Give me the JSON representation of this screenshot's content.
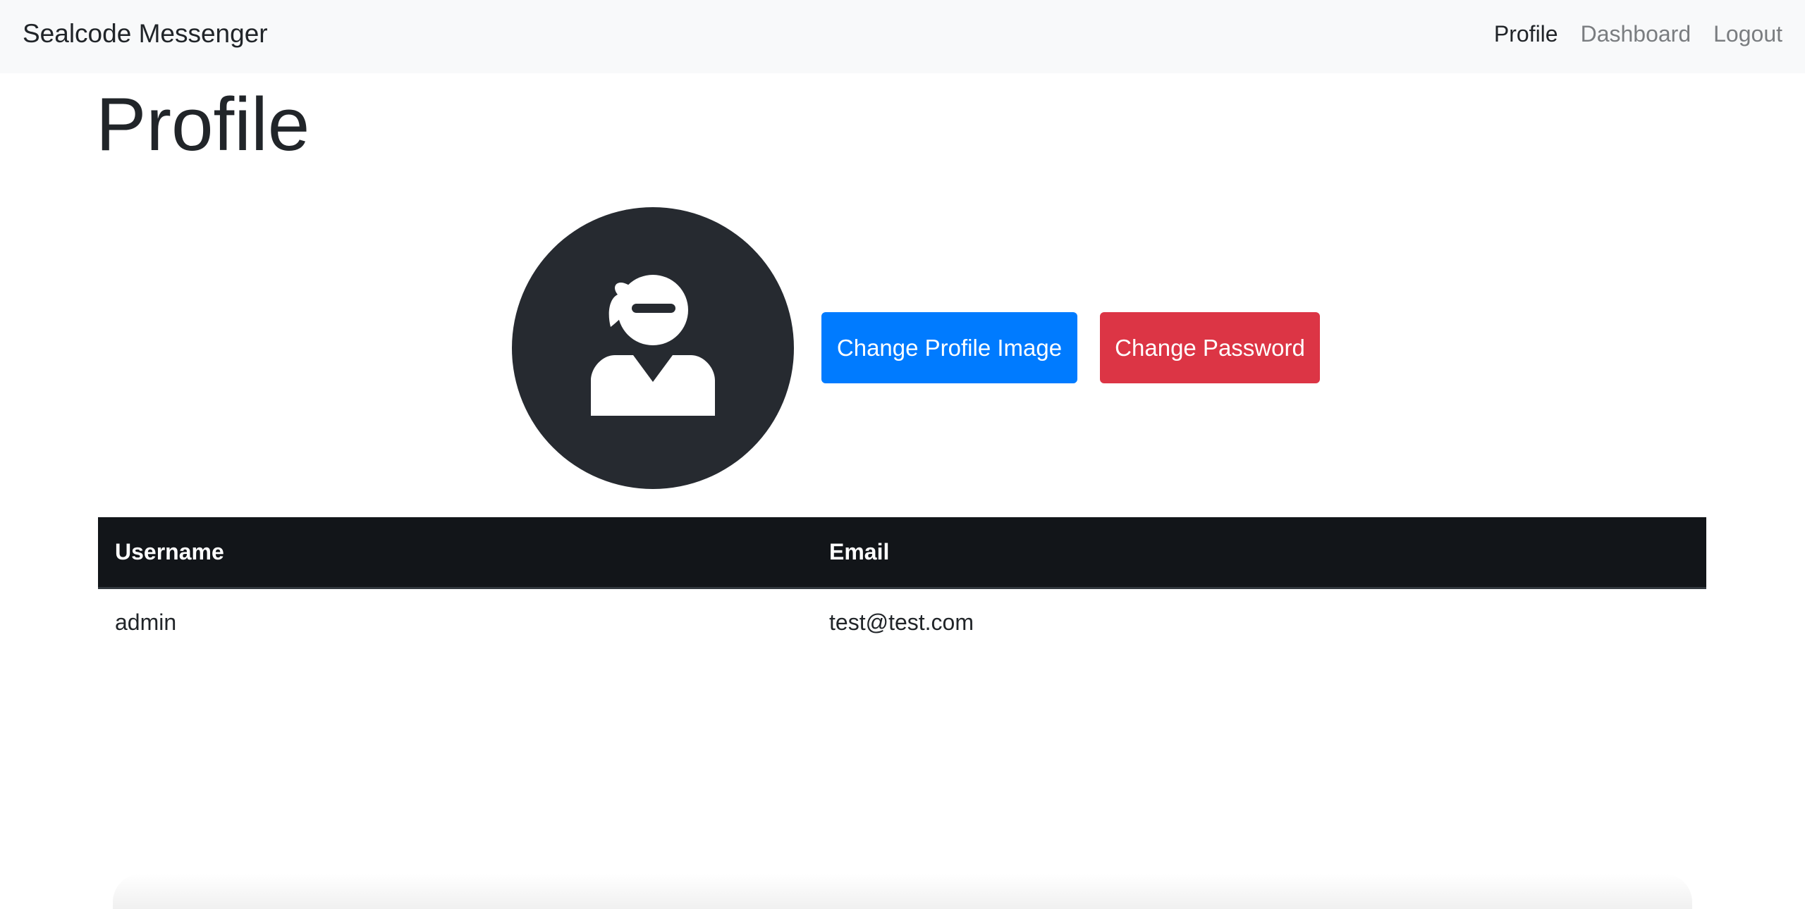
{
  "navbar": {
    "brand": "Sealcode Messenger",
    "links": [
      {
        "label": "Profile",
        "active": true
      },
      {
        "label": "Dashboard",
        "active": false
      },
      {
        "label": "Logout",
        "active": false
      }
    ]
  },
  "page": {
    "title": "Profile"
  },
  "profile": {
    "avatar_icon": "ninja-user-icon",
    "change_image_label": "Change Profile Image",
    "change_password_label": "Change Password"
  },
  "table": {
    "headers": [
      "Username",
      "Email"
    ],
    "rows": [
      [
        "admin",
        "test@test.com"
      ]
    ]
  },
  "colors": {
    "navbar_bg": "#f8f9fa",
    "primary": "#007bff",
    "danger": "#dc3545",
    "table_header_bg": "#121519",
    "avatar_bg": "#262a30"
  }
}
